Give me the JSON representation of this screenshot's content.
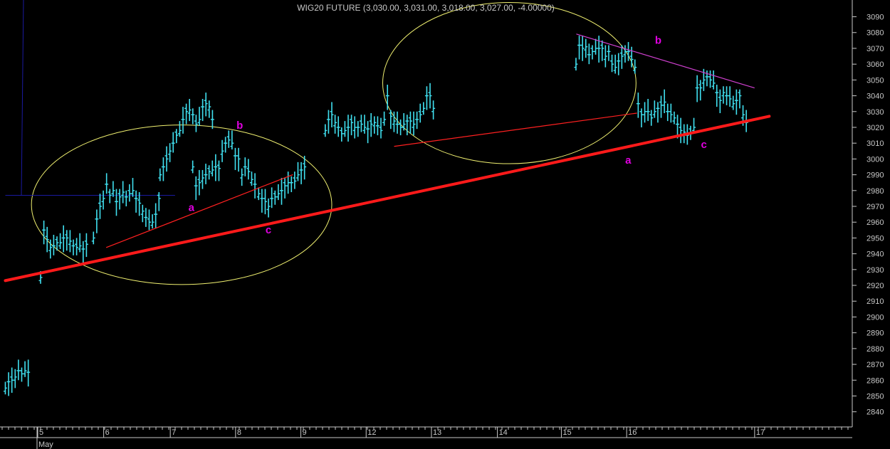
{
  "chart_data": {
    "type": "ohlc",
    "title": "WIG20 FUTURE (3,030.00, 3,031.00, 3,018.00, 3,027.00, -4.00000)",
    "y_ticks": [
      2840,
      2850,
      2860,
      2870,
      2880,
      2890,
      2900,
      2910,
      2920,
      2930,
      2940,
      2950,
      2960,
      2970,
      2980,
      2990,
      3000,
      3010,
      3020,
      3030,
      3040,
      3050,
      3060,
      3070,
      3080,
      3090
    ],
    "ylim": [
      2834,
      3097
    ],
    "x_tick_labels": [
      "5",
      "6",
      "7",
      "8",
      "9",
      "12",
      "13",
      "14",
      "15",
      "16",
      "17"
    ],
    "month_label": "May",
    "grid": false,
    "colors": {
      "background": "#000000",
      "bars": "#40e0f0",
      "main_trendline": "#ff1a1a",
      "thin_trendline": "#ff2020",
      "resistance_line": "#d040d0",
      "ellipse": "#f0f070",
      "reference_line": "#1a1aa0",
      "wave_labels": "#e000e0",
      "axis_text": "#c8c8c8"
    },
    "wave_labels": [
      {
        "text": "b",
        "x": 7.79,
        "y": 3019
      },
      {
        "text": "a",
        "x": 7.05,
        "y": 2967
      },
      {
        "text": "c",
        "x": 8.23,
        "y": 2953
      },
      {
        "text": "b",
        "x": 14.2,
        "y": 3073
      },
      {
        "text": "a",
        "x": 13.74,
        "y": 2997
      },
      {
        "text": "c",
        "x": 14.9,
        "y": 3007
      }
    ],
    "trendlines": [
      {
        "role": "main",
        "x": [
          4.2,
          15.9
        ],
        "y": [
          2923,
          3027
        ]
      },
      {
        "role": "thin",
        "x": [
          5.75,
          8.6
        ],
        "y": [
          2944,
          2990
        ]
      },
      {
        "role": "thin",
        "x": [
          10.16,
          13.87
        ],
        "y": [
          3008,
          3029
        ]
      },
      {
        "role": "resistance",
        "x": [
          12.95,
          15.67
        ],
        "y": [
          3079,
          3045
        ]
      }
    ],
    "ellipses": [
      {
        "cx": 6.9,
        "cy": 2971,
        "rx": 2.3,
        "ry": 50.5
      },
      {
        "cx": 11.92,
        "cy": 3048,
        "rx": 1.94,
        "ry": 51
      }
    ],
    "reference_lines": [
      {
        "x": [
          4.2,
          6.8
        ],
        "y": [
          2977,
          2977
        ]
      }
    ],
    "sessions": [
      {
        "label": "",
        "start": 4.2,
        "base": [
          2855,
          2859,
          2860,
          2862,
          2866,
          2864,
          2866,
          2865
        ]
      },
      {
        "label": "5",
        "start": 4.74,
        "base": [
          2925,
          2955,
          2949,
          2944,
          2945,
          2947,
          2947,
          2950,
          2950,
          2948,
          2945,
          2944,
          2945,
          2943,
          2946
        ]
      },
      {
        "label": "6",
        "start": 5.55,
        "base": [
          2950,
          2962,
          2970,
          2975,
          2984,
          2977,
          2980,
          2973,
          2976,
          2979,
          2976,
          2978,
          2980,
          2975,
          2972,
          2967,
          2963,
          2960,
          2960,
          2965,
          2975
        ]
      },
      {
        "label": "7",
        "start": 6.57,
        "base": [
          2990,
          2995,
          3000,
          3005,
          3010,
          3015,
          3018,
          3025,
          3030,
          3031,
          3028,
          3022,
          3025,
          3033,
          3035,
          3033,
          3025
        ]
      },
      {
        "label": "8",
        "start": 7.07,
        "base": [
          2995,
          2983,
          2985,
          2988,
          2990,
          2992,
          2993,
          2995,
          2994,
          3005,
          3010,
          3012,
          3010,
          3002,
          3000,
          2990,
          2995,
          2992,
          2987,
          2984
        ]
      },
      {
        "label": "9",
        "start": 8.08,
        "base": [
          2978,
          2975,
          2973,
          2970,
          2975,
          2976,
          2978,
          2980,
          2983,
          2985,
          2985,
          2986,
          2990,
          2993,
          2995
        ]
      },
      {
        "label": "12",
        "start": 9.1,
        "base": [
          3018,
          3025,
          3028,
          3023,
          3020,
          3016,
          3018,
          3020,
          3023,
          3020,
          3020,
          3022,
          3020,
          3019,
          3022,
          3023,
          3021,
          3018,
          3025,
          3040,
          3027,
          3024,
          3022,
          3020,
          3022,
          3024,
          3024,
          3022,
          3025,
          3028,
          3032,
          3040,
          3040,
          3032
        ]
      },
      {
        "label": "14",
        "start": 12.94,
        "base": [
          3060,
          3072,
          3070,
          3071,
          3066,
          3068,
          3070,
          3070,
          3070,
          3065,
          3068,
          3060,
          3058,
          3062,
          3065,
          3068,
          3068,
          3063,
          3058,
          3035,
          3028,
          3030,
          3030,
          3026,
          3030,
          3032,
          3034,
          3036,
          3030,
          3028,
          3026,
          3022,
          3018,
          3017,
          3015,
          3017,
          3020,
          3045,
          3045,
          3050,
          3052,
          3050,
          3048,
          3042,
          3037,
          3042,
          3040,
          3038,
          3035,
          3037,
          3040,
          3028,
          3023
        ]
      }
    ]
  }
}
